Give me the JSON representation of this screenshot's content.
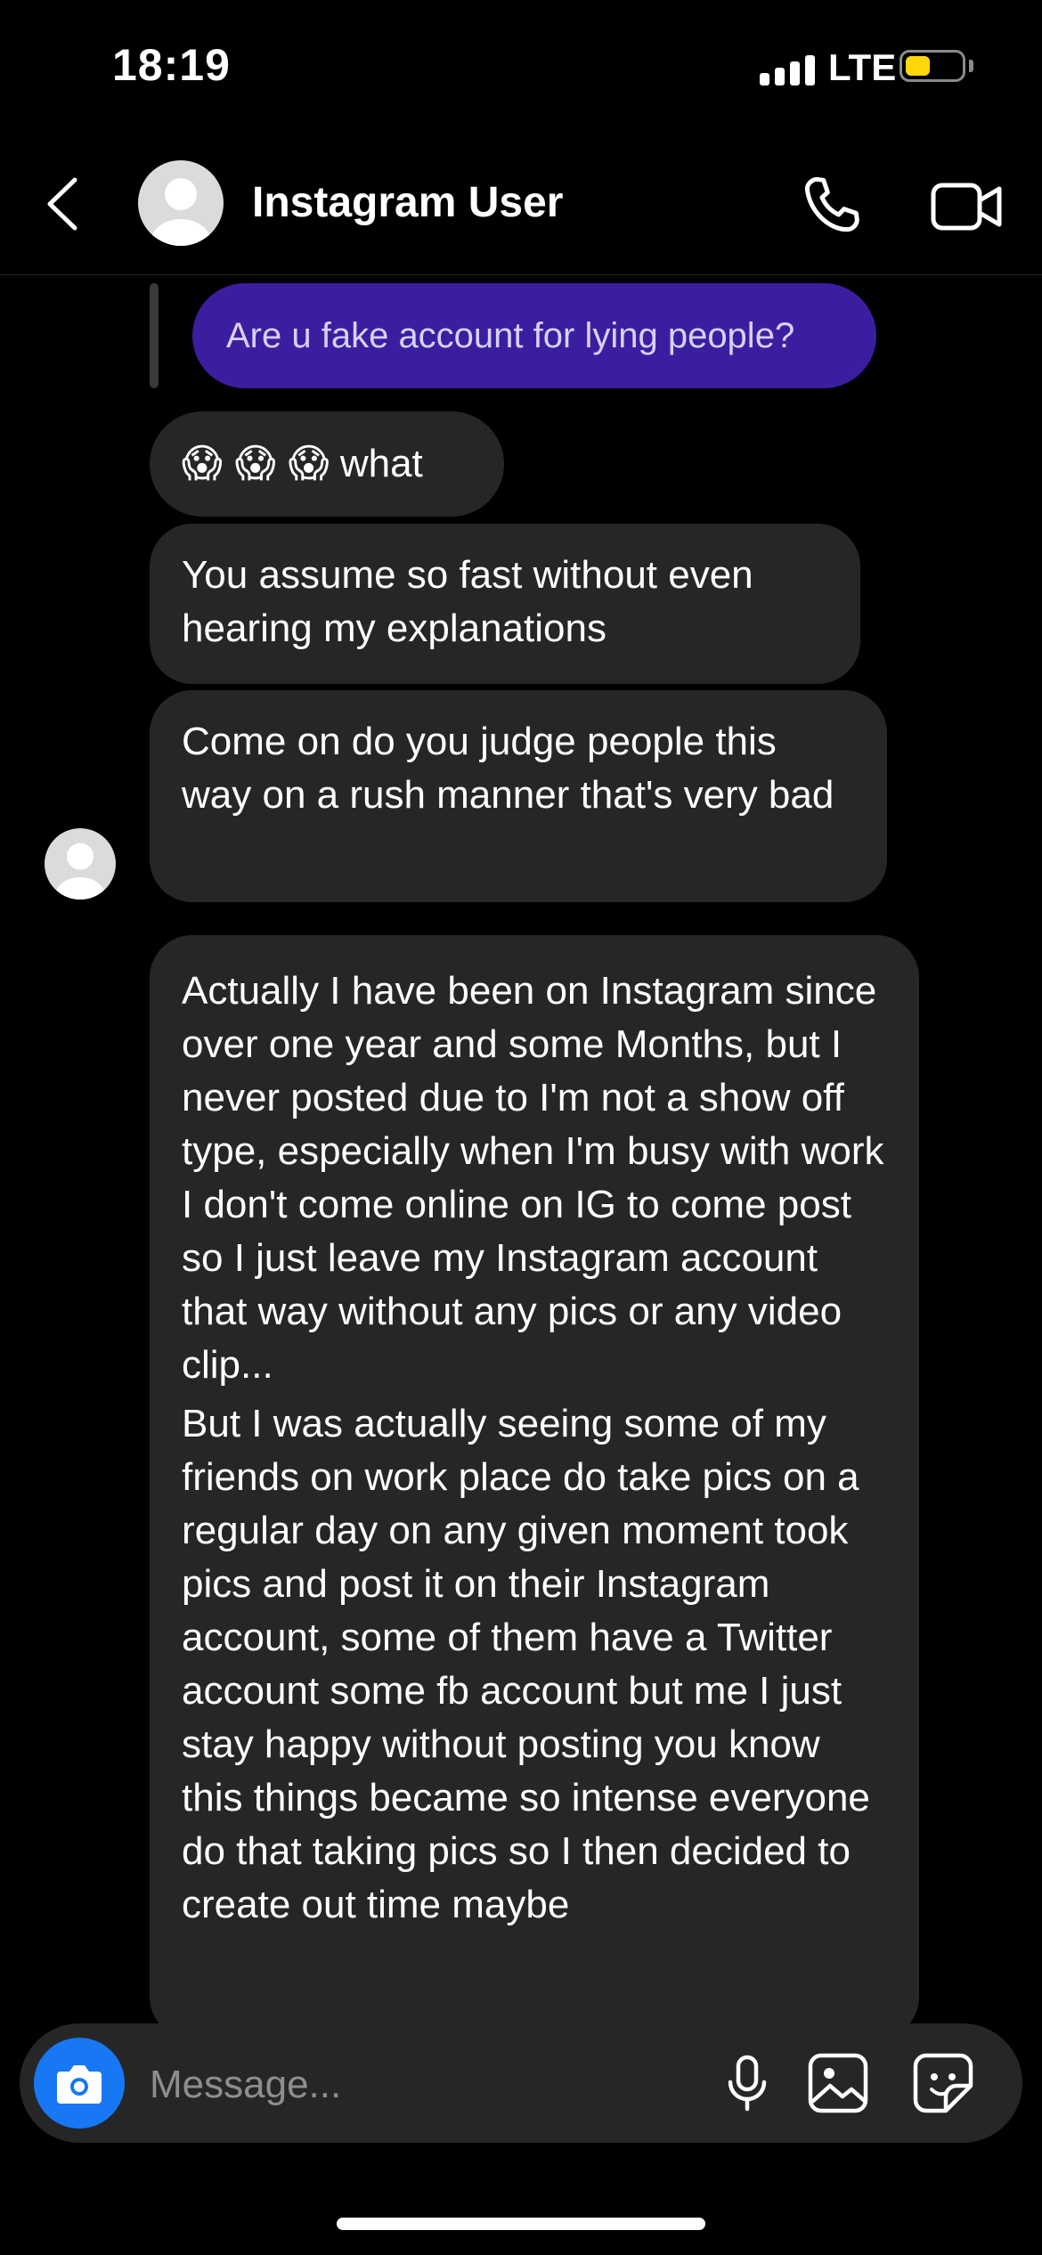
{
  "status_bar": {
    "time": "18:19",
    "network": "LTE",
    "battery_level": 0.45,
    "battery_color": "#ffd60a"
  },
  "header": {
    "contact_name": "Instagram User"
  },
  "messages": [
    {
      "sender": "me",
      "replied_text": "Are u fake account for lying people?"
    },
    {
      "sender": "them",
      "emoji": "😱 😱 😱",
      "text": "what"
    },
    {
      "sender": "them",
      "text": "You assume so fast without even hearing my explanations"
    },
    {
      "sender": "them",
      "text": "Come on do you judge people this way on a rush manner that's very bad"
    },
    {
      "sender": "them",
      "paragraphs": [
        "Actually I have been on Instagram since over one year and some Months, but I never posted due to I'm not a show off type, especially when I'm busy with work I don't come online on IG to come post so I just leave my Instagram account that way without any pics or any video clip...",
        "But I was actually seeing some of my friends on work place do take pics on a regular day on any given moment took pics and post it on their Instagram account, some of them have a Twitter account some fb account but me I just stay happy without posting you know this things became so intense everyone do that taking pics so I then decided to create out time maybe"
      ]
    }
  ],
  "composer": {
    "placeholder": "Message..."
  },
  "colors": {
    "sent_bubble": "#3b1ea0",
    "received_bubble": "#262626",
    "camera_button": "#1877f2"
  },
  "icons": [
    "back-icon",
    "call-icon",
    "video-call-icon",
    "camera-icon",
    "microphone-icon",
    "gallery-icon",
    "sticker-icon"
  ]
}
